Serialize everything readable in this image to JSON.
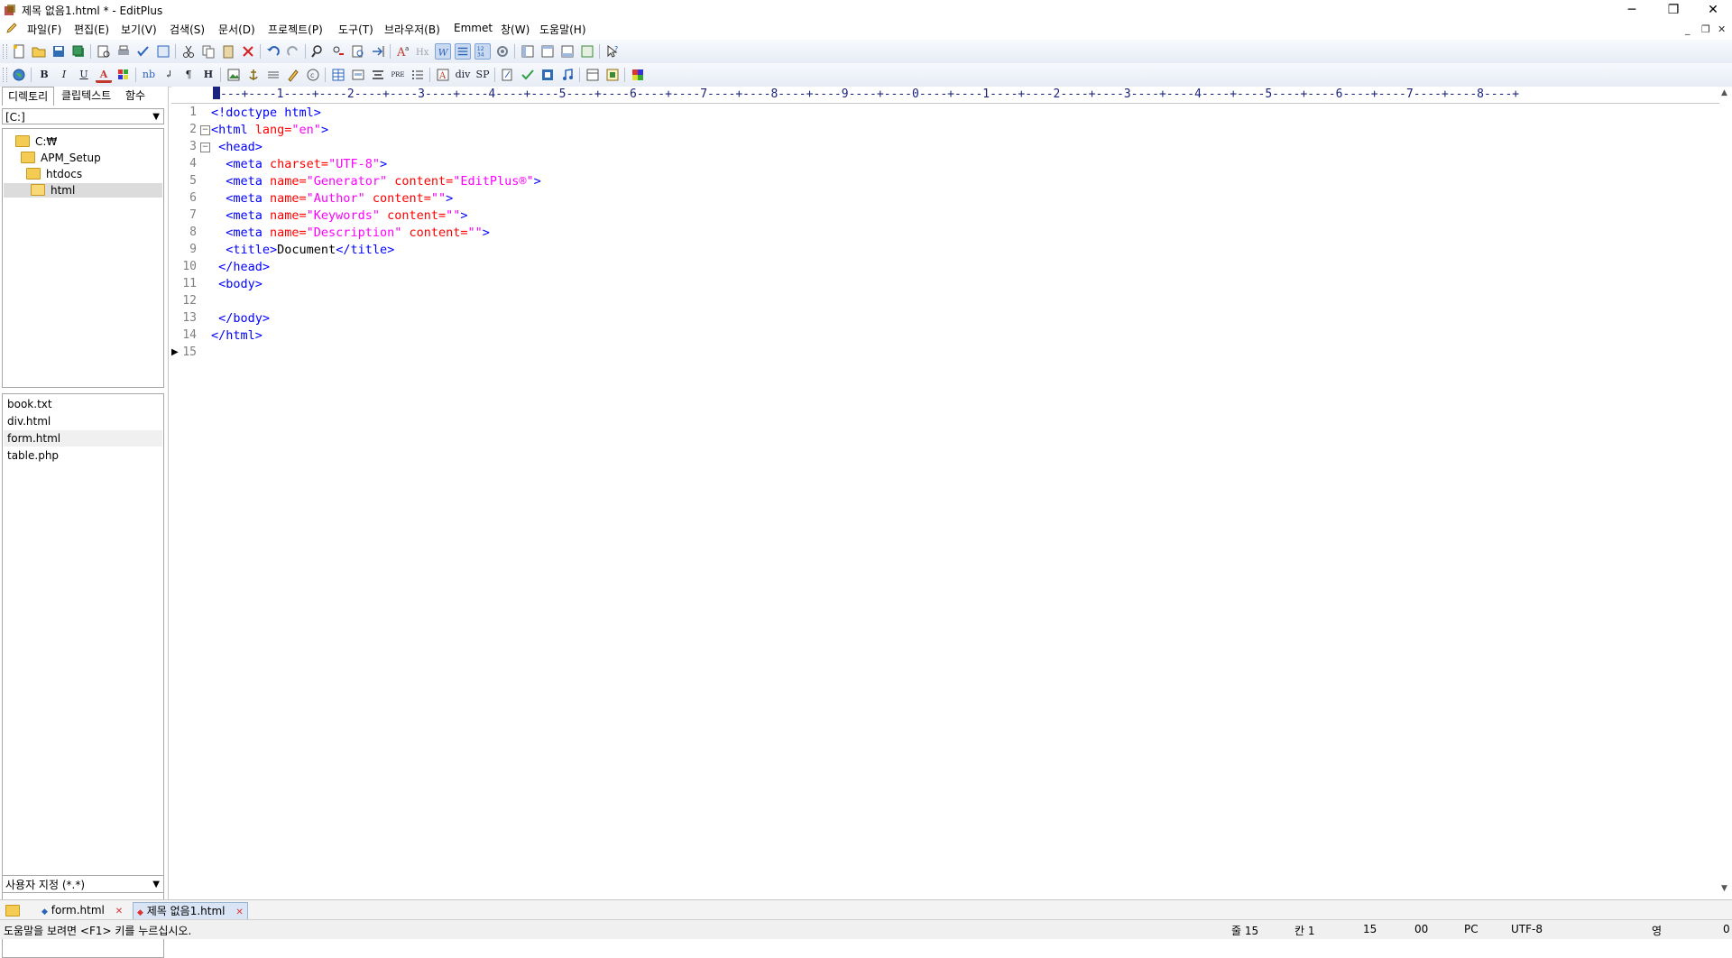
{
  "window": {
    "title": "제목 없음1.html * - EditPlus",
    "minimize": "─",
    "maximize": "❐",
    "close": "✕",
    "mdi_minimize": "_",
    "mdi_restore": "❐",
    "mdi_close": "✕"
  },
  "menu": [
    "파일(F)",
    "편집(E)",
    "보기(V)",
    "검색(S)",
    "문서(D)",
    "프로젝트(P)",
    "도구(T)",
    "브라우저(B)",
    "Emmet",
    "창(W)",
    "도움말(H)"
  ],
  "html_toolbar_text": {
    "bold": "B",
    "italic": "I",
    "underline": "U",
    "font": "A",
    "nbsp": "nb",
    "br": "↲",
    "para": "¶",
    "heading": "H",
    "pre": "PRE",
    "div": "div",
    "span": "SP"
  },
  "left_panel": {
    "tabs": [
      "디렉토리",
      "클립텍스트",
      "함수"
    ],
    "drive": "[C:]",
    "tree": [
      "C:₩",
      "APM_Setup",
      "htdocs",
      "html"
    ],
    "files": [
      "book.txt",
      "div.html",
      "form.html",
      "table.php"
    ],
    "filter": "사용자 지정 (*.*)"
  },
  "editor": {
    "ruler": "---+----1----+----2----+----3----+----4----+----5----+----6----+----7----+----8----+----9----+----0----+----1----+----2----+----3----+----4----+----5----+----6----+----7----+----8----+",
    "line_numbers": [
      "1",
      "2",
      "3",
      "4",
      "5",
      "6",
      "7",
      "8",
      "9",
      "10",
      "11",
      "12",
      "13",
      "14",
      "15"
    ]
  },
  "doc_tabs": [
    {
      "label": "form.html"
    },
    {
      "label": "제목 없음1.html"
    }
  ],
  "status": {
    "help": "도움말을 보려면 <F1> 키를 누르십시오.",
    "line": "줄 15",
    "col": "칸 1",
    "total": "15",
    "code": "00",
    "eol": "PC",
    "encoding": "UTF-8",
    "mode": "영",
    "extra": "0"
  },
  "code_lines": [
    [
      [
        "t-tag",
        "<!doctype html>"
      ]
    ],
    [
      [
        "t-tag",
        "<html "
      ],
      [
        "t-attr",
        "lang="
      ],
      [
        "t-str",
        "\"en\""
      ],
      [
        "t-tag",
        ">"
      ]
    ],
    [
      [
        "t-tag",
        " <head>"
      ]
    ],
    [
      [
        "t-tag",
        "  <meta "
      ],
      [
        "t-attr",
        "charset="
      ],
      [
        "t-str",
        "\"UTF-8\""
      ],
      [
        "t-tag",
        ">"
      ]
    ],
    [
      [
        "t-tag",
        "  <meta "
      ],
      [
        "t-attr",
        "name="
      ],
      [
        "t-str",
        "\"Generator\""
      ],
      [
        "t-attr",
        " content="
      ],
      [
        "t-str",
        "\"EditPlus®\""
      ],
      [
        "t-tag",
        ">"
      ]
    ],
    [
      [
        "t-tag",
        "  <meta "
      ],
      [
        "t-attr",
        "name="
      ],
      [
        "t-str",
        "\"Author\""
      ],
      [
        "t-attr",
        " content="
      ],
      [
        "t-str",
        "\"\""
      ],
      [
        "t-tag",
        ">"
      ]
    ],
    [
      [
        "t-tag",
        "  <meta "
      ],
      [
        "t-attr",
        "name="
      ],
      [
        "t-str",
        "\"Keywords\""
      ],
      [
        "t-attr",
        " content="
      ],
      [
        "t-str",
        "\"\""
      ],
      [
        "t-tag",
        ">"
      ]
    ],
    [
      [
        "t-tag",
        "  <meta "
      ],
      [
        "t-attr",
        "name="
      ],
      [
        "t-str",
        "\"Description\""
      ],
      [
        "t-attr",
        " content="
      ],
      [
        "t-str",
        "\"\""
      ],
      [
        "t-tag",
        ">"
      ]
    ],
    [
      [
        "t-tag",
        "  <title>"
      ],
      [
        "t-txt",
        "Document"
      ],
      [
        "t-tag",
        "</title>"
      ]
    ],
    [
      [
        "t-tag",
        " </head>"
      ]
    ],
    [
      [
        "t-tag",
        " <body>"
      ]
    ],
    [],
    [
      [
        "t-tag",
        " </body>"
      ]
    ],
    [
      [
        "t-tag",
        "</html>"
      ]
    ],
    []
  ]
}
